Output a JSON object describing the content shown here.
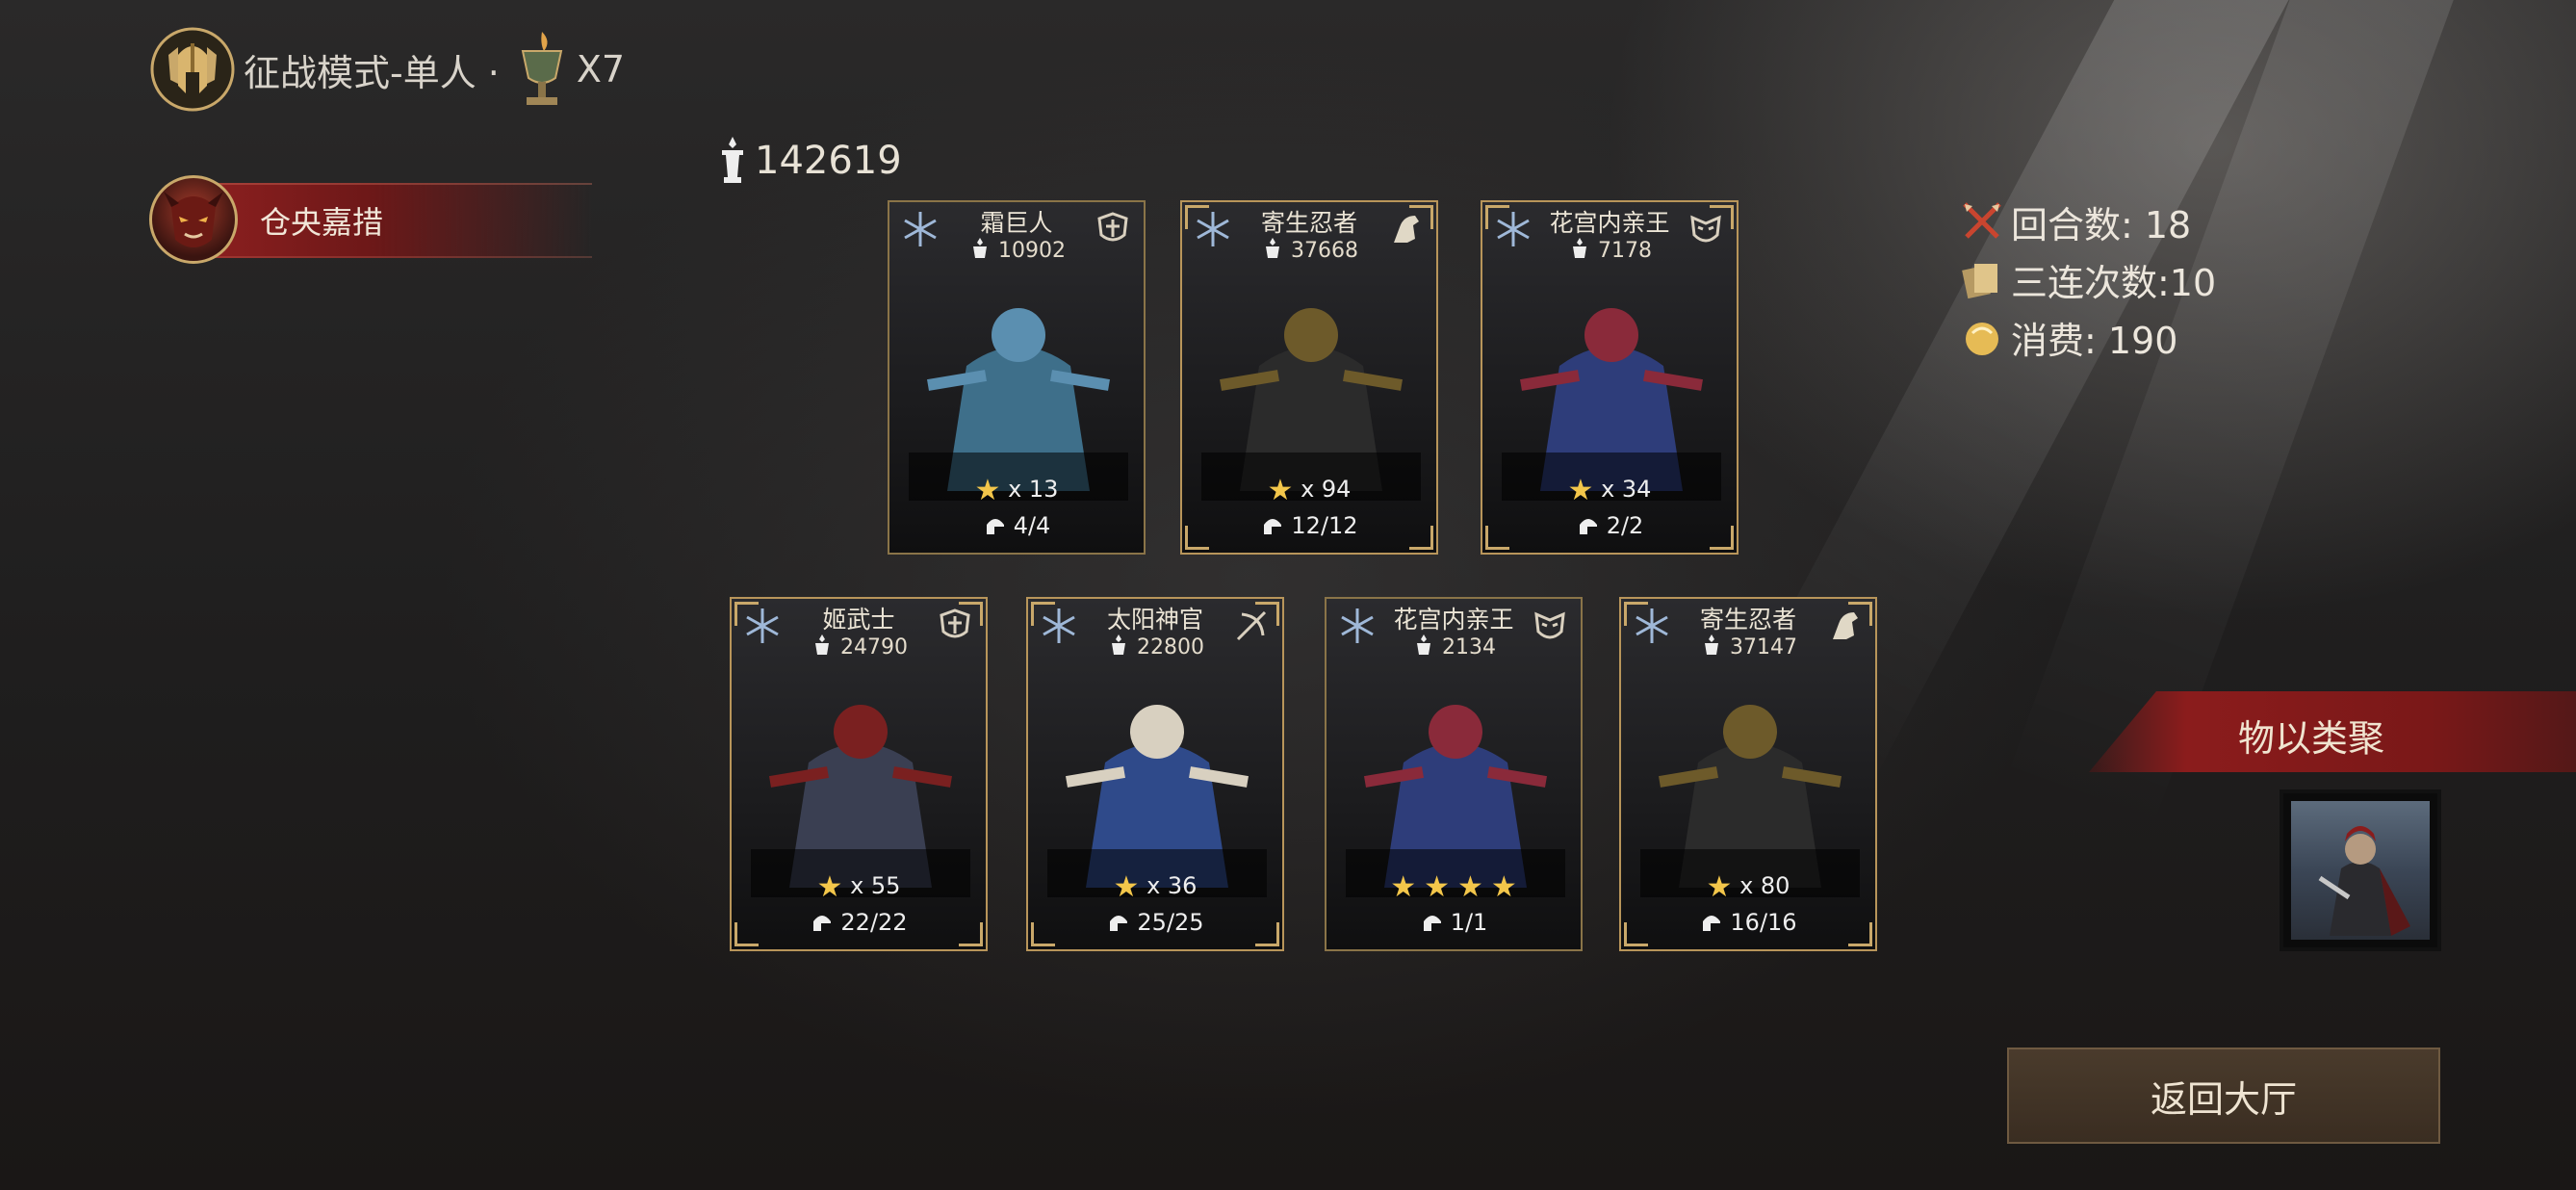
{
  "header": {
    "mode_title": "征战模式-单人 ·",
    "cup_count": "X7"
  },
  "player": {
    "name": "仓央嘉措"
  },
  "team_power": "142619",
  "cards": [
    {
      "name": "霜巨人",
      "power": "10902",
      "stars": "x 13",
      "count": "4/4",
      "star_mode": "count"
    },
    {
      "name": "寄生忍者",
      "power": "37668",
      "stars": "x 94",
      "count": "12/12",
      "star_mode": "count"
    },
    {
      "name": "花宫内亲王",
      "power": "7178",
      "stars": "x 34",
      "count": "2/2",
      "star_mode": "count"
    },
    {
      "name": "姬武士",
      "power": "24790",
      "stars": "x 55",
      "count": "22/22",
      "star_mode": "count"
    },
    {
      "name": "太阳神官",
      "power": "22800",
      "stars": "x 36",
      "count": "25/25",
      "star_mode": "count"
    },
    {
      "name": "花宫内亲王",
      "power": "2134",
      "stars": "",
      "star_icons": 4,
      "count": "1/1",
      "star_mode": "icons"
    },
    {
      "name": "寄生忍者",
      "power": "37147",
      "stars": "x 80",
      "count": "16/16",
      "star_mode": "count"
    }
  ],
  "stats": {
    "rounds": "回合数: 18",
    "triples": "三连次数:10",
    "spent": "消费: 190"
  },
  "banner": "物以类聚",
  "back_button": "返回大厅",
  "colors": {
    "gold": "#c9a86a",
    "red": "#8b1c1c",
    "star": "#f3c64a"
  }
}
